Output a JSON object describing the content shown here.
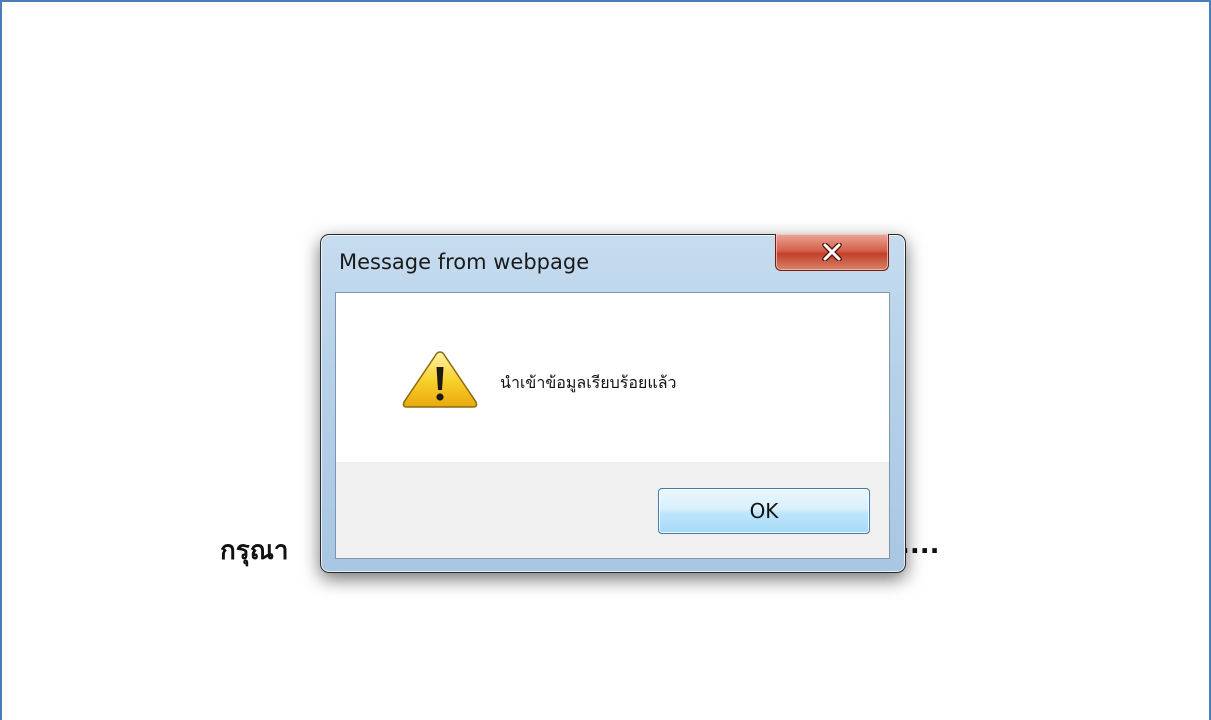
{
  "page": {
    "text_left": "กรุณา",
    "text_right": "...."
  },
  "dialog": {
    "title": "Message from webpage",
    "close_icon": "close-x-icon",
    "warning_icon": "warning-triangle-icon",
    "message": "นำเข้าข้อมูลเรียบร้อยแล้ว",
    "ok_label": "OK"
  },
  "colors": {
    "frame_border": "#4a7db8",
    "close_button": "#c2412b",
    "ok_button": "#bee6fd",
    "warning_fill": "#f5c518"
  }
}
